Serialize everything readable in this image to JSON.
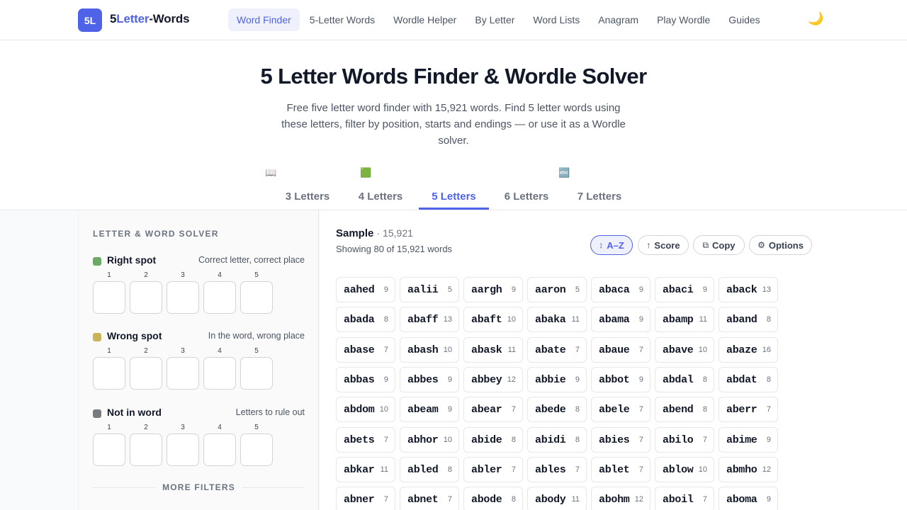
{
  "header": {
    "logo_badge": "5L",
    "logo_prefix": "5",
    "logo_accent": "Letter",
    "logo_suffix": "-Words",
    "nav": [
      "Word Finder",
      "5-Letter Words",
      "Wordle Helper",
      "By Letter",
      "Word Lists",
      "Anagram",
      "Play Wordle",
      "Guides"
    ],
    "active_nav": "Word Finder",
    "theme_icon": "🌙"
  },
  "hero": {
    "title": "5 Letter Words Finder & Wordle Solver",
    "description": "Free five letter word finder with 15,921 words. Find 5 letter words using these letters, filter by position, starts and endings — or use it as a Wordle solver."
  },
  "tab_icons": [
    "📖",
    "🟩",
    "🔤"
  ],
  "tabs": [
    "3 Letters",
    "4 Letters",
    "5 Letters",
    "6 Letters",
    "7 Letters"
  ],
  "active_tab": "5 Letters",
  "sidebar": {
    "heading": "LETTER & WORD SOLVER",
    "groups": [
      {
        "title": "Right spot",
        "hint": "Correct letter, correct place",
        "color": "#6aaa64"
      },
      {
        "title": "Wrong spot",
        "hint": "In the word, wrong place",
        "color": "#c9b458"
      },
      {
        "title": "Not in word",
        "hint": "Letters to rule out",
        "color": "#787c7e"
      }
    ],
    "slot_numbers": [
      "1",
      "2",
      "3",
      "4",
      "5"
    ],
    "more_filters": "MORE FILTERS"
  },
  "results": {
    "title": "Sample",
    "count": "· 15,921",
    "showing": "Showing 80 of 15,921 words",
    "buttons": [
      {
        "icon": "↕",
        "label": "A–Z",
        "active": true
      },
      {
        "icon": "↑",
        "label": "Score",
        "active": false
      },
      {
        "icon": "⧉",
        "label": "Copy",
        "active": false
      },
      {
        "icon": "⚙",
        "label": "Options",
        "active": false
      }
    ],
    "words": [
      [
        "aahed",
        "9"
      ],
      [
        "aalii",
        "5"
      ],
      [
        "aargh",
        "9"
      ],
      [
        "aaron",
        "5"
      ],
      [
        "abaca",
        "9"
      ],
      [
        "abaci",
        "9"
      ],
      [
        "aback",
        "13"
      ],
      [
        "abada",
        "8"
      ],
      [
        "abaff",
        "13"
      ],
      [
        "abaft",
        "10"
      ],
      [
        "abaka",
        "11"
      ],
      [
        "abama",
        "9"
      ],
      [
        "abamp",
        "11"
      ],
      [
        "aband",
        "8"
      ],
      [
        "abase",
        "7"
      ],
      [
        "abash",
        "10"
      ],
      [
        "abask",
        "11"
      ],
      [
        "abate",
        "7"
      ],
      [
        "abaue",
        "7"
      ],
      [
        "abave",
        "10"
      ],
      [
        "abaze",
        "16"
      ],
      [
        "abbas",
        "9"
      ],
      [
        "abbes",
        "9"
      ],
      [
        "abbey",
        "12"
      ],
      [
        "abbie",
        "9"
      ],
      [
        "abbot",
        "9"
      ],
      [
        "abdal",
        "8"
      ],
      [
        "abdat",
        "8"
      ],
      [
        "abdom",
        "10"
      ],
      [
        "abeam",
        "9"
      ],
      [
        "abear",
        "7"
      ],
      [
        "abede",
        "8"
      ],
      [
        "abele",
        "7"
      ],
      [
        "abend",
        "8"
      ],
      [
        "aberr",
        "7"
      ],
      [
        "abets",
        "7"
      ],
      [
        "abhor",
        "10"
      ],
      [
        "abide",
        "8"
      ],
      [
        "abidi",
        "8"
      ],
      [
        "abies",
        "7"
      ],
      [
        "abilo",
        "7"
      ],
      [
        "abime",
        "9"
      ],
      [
        "abkar",
        "11"
      ],
      [
        "abled",
        "8"
      ],
      [
        "abler",
        "7"
      ],
      [
        "ables",
        "7"
      ],
      [
        "ablet",
        "7"
      ],
      [
        "ablow",
        "10"
      ],
      [
        "abmho",
        "12"
      ],
      [
        "abner",
        "7"
      ],
      [
        "abnet",
        "7"
      ],
      [
        "abode",
        "8"
      ],
      [
        "abody",
        "11"
      ],
      [
        "abohm",
        "12"
      ],
      [
        "aboil",
        "7"
      ],
      [
        "aboma",
        "9"
      ]
    ]
  }
}
